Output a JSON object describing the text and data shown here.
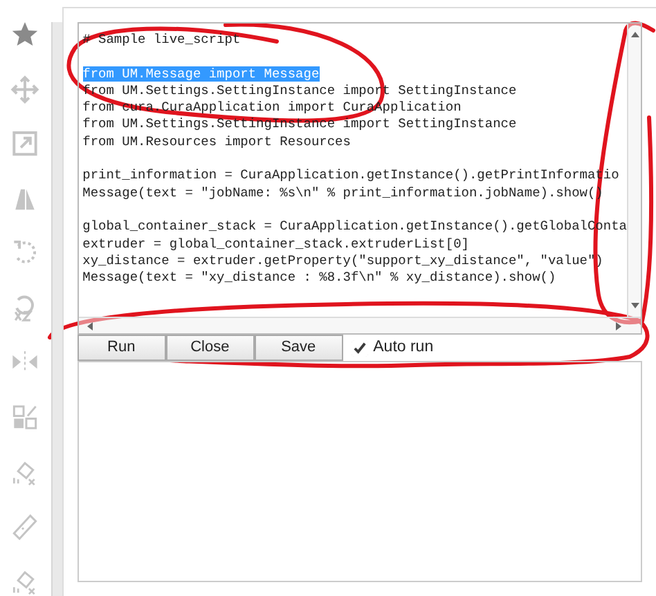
{
  "toolbar": [
    {
      "kind": "star",
      "selected": true
    },
    {
      "kind": "move",
      "selected": false
    },
    {
      "kind": "scale",
      "selected": false
    },
    {
      "kind": "shape",
      "selected": false
    },
    {
      "kind": "rotate",
      "selected": false
    },
    {
      "kind": "reset",
      "selected": false
    },
    {
      "kind": "mirror",
      "selected": false
    },
    {
      "kind": "grid",
      "selected": false
    },
    {
      "kind": "eraser",
      "selected": false
    },
    {
      "kind": "ruler",
      "selected": false
    },
    {
      "kind": "eraser",
      "selected": false
    }
  ],
  "editor": {
    "lines": [
      {
        "kind": "code",
        "text": "# Sample live_script",
        "selected": false
      },
      {
        "kind": "blank"
      },
      {
        "kind": "code",
        "text": "from UM.Message import Message",
        "selected": true
      },
      {
        "kind": "code",
        "text": "from UM.Settings.SettingInstance import SettingInstance",
        "selected": false
      },
      {
        "kind": "code",
        "text": "from cura.CuraApplication import CuraApplication",
        "selected": false
      },
      {
        "kind": "code",
        "text": "from UM.Settings.SettingInstance import SettingInstance",
        "selected": false
      },
      {
        "kind": "code",
        "text": "from UM.Resources import Resources",
        "selected": false
      },
      {
        "kind": "blank"
      },
      {
        "kind": "code",
        "text": "print_information = CuraApplication.getInstance().getPrintInformatio",
        "selected": false
      },
      {
        "kind": "code",
        "text": "Message(text = \"jobName: %s\\n\" % print_information.jobName).show()",
        "selected": false
      },
      {
        "kind": "blank"
      },
      {
        "kind": "code",
        "text": "global_container_stack = CuraApplication.getInstance().getGlobalConta",
        "selected": false
      },
      {
        "kind": "code",
        "text": "extruder = global_container_stack.extruderList[0]",
        "selected": false
      },
      {
        "kind": "code",
        "text": "xy_distance = extruder.getProperty(\"support_xy_distance\", \"value\")",
        "selected": false
      },
      {
        "kind": "code",
        "text": "Message(text = \"xy_distance : %8.3f\\n\" % xy_distance).show()",
        "selected": false
      }
    ]
  },
  "buttons": [
    "Run",
    "Close",
    "Save"
  ],
  "auto_run": {
    "label": "Auto run",
    "checked": true
  },
  "annotations": [
    {
      "kind": "ellipse"
    },
    {
      "kind": "vertical-loop"
    },
    {
      "kind": "horizontal-loop"
    }
  ]
}
